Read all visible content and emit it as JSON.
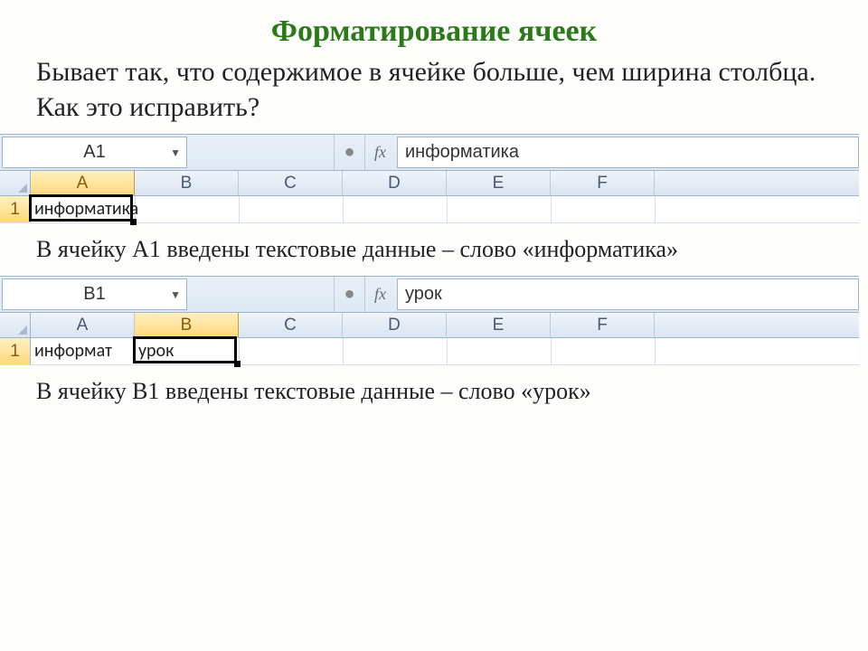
{
  "title": "Форматирование ячеек",
  "intro": "Бывает так, что содержимое в ячейке больше, чем ширина столбца. Как это исправить?",
  "caption1": "В ячейку А1 введены текстовые данные – слово «информатика»",
  "caption2": "В ячейку В1 введены текстовые данные – слово «урок»",
  "cols": [
    "A",
    "B",
    "C",
    "D",
    "E",
    "F"
  ],
  "excel1": {
    "nameBox": "A1",
    "fx": "fx",
    "formula": "информатика",
    "rowNum": "1",
    "a1": "информатика",
    "selectedCol": "A"
  },
  "excel2": {
    "nameBox": "B1",
    "fx": "fx",
    "formula": "урок",
    "rowNum": "1",
    "a1": "информат",
    "b1": "урок",
    "selectedCol": "B"
  }
}
